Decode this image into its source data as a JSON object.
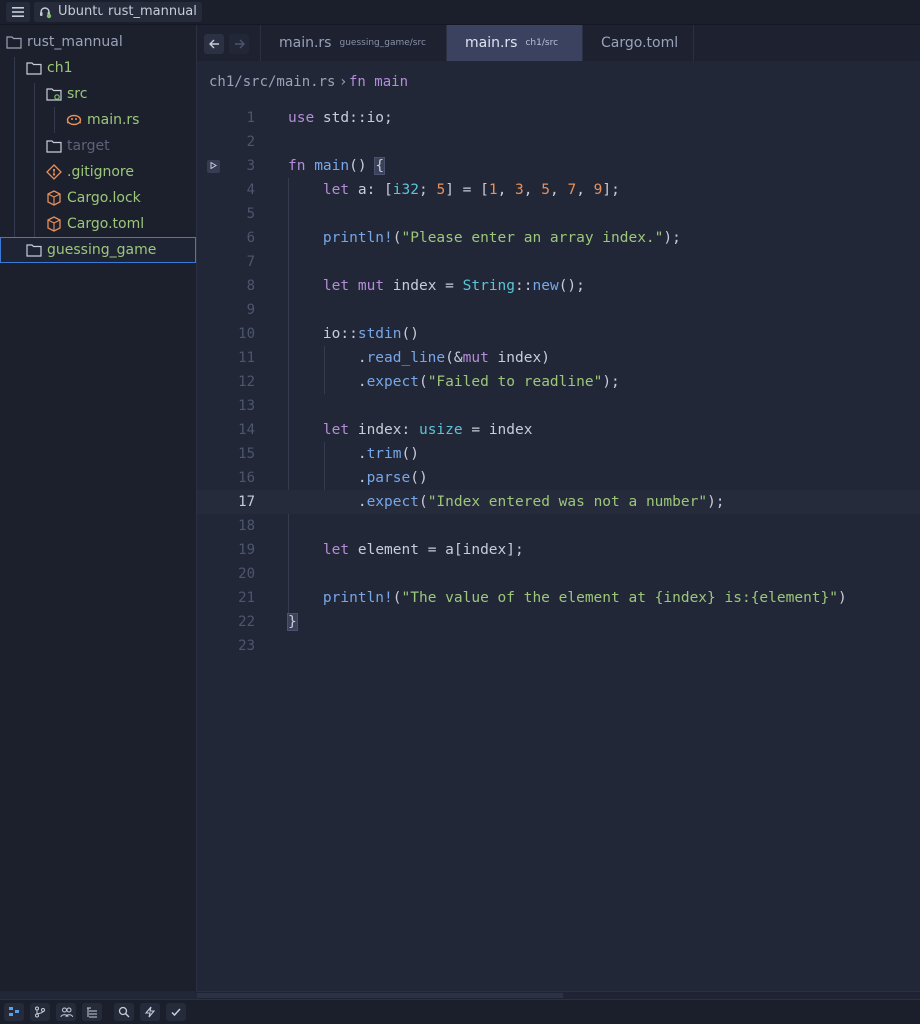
{
  "titlebar": {
    "os_label": "Ubuntu",
    "project_label": "rust_mannual"
  },
  "sidebar": {
    "root": "rust_mannual",
    "items": [
      {
        "label": "ch1",
        "kind": "folder-open"
      },
      {
        "label": "src",
        "kind": "folder-src"
      },
      {
        "label": "main.rs",
        "kind": "rust-file"
      },
      {
        "label": "target",
        "kind": "folder-closed"
      },
      {
        "label": ".gitignore",
        "kind": "git-file"
      },
      {
        "label": "Cargo.lock",
        "kind": "cargo-file"
      },
      {
        "label": "Cargo.toml",
        "kind": "cargo-file"
      },
      {
        "label": "guessing_game",
        "kind": "folder-closed"
      }
    ]
  },
  "tabs": [
    {
      "label": "main.rs",
      "sub": "guessing_game/src"
    },
    {
      "label": "main.rs",
      "sub": "ch1/src"
    },
    {
      "label": "Cargo.toml",
      "sub": ""
    }
  ],
  "breadcrumb": {
    "path": "ch1/src/main.rs",
    "separator": "›",
    "symbol": "fn main"
  },
  "editor": {
    "line_numbers": [
      "1",
      "2",
      "3",
      "4",
      "5",
      "6",
      "7",
      "8",
      "9",
      "10",
      "11",
      "12",
      "13",
      "14",
      "15",
      "16",
      "17",
      "18",
      "19",
      "20",
      "21",
      "22",
      "23"
    ],
    "current_line": "17",
    "code": {
      "l1_kw": "use",
      "l1_rest": " std::io;",
      "l3_kw": "fn",
      "l3_fn": " main",
      "l3_paren": "() ",
      "l3_brace": "{",
      "l4_kw": "let",
      "l4_a": " a: [",
      "l4_ty": "i32",
      "l4_semi": "; ",
      "l4_n5": "5",
      "l4_eq": "] = [",
      "l4_n1": "1",
      "l4_c1": ", ",
      "l4_n3": "3",
      "l4_c2": ", ",
      "l4_n5b": "5",
      "l4_c3": ", ",
      "l4_n7": "7",
      "l4_c4": ", ",
      "l4_n9": "9",
      "l4_end": "];",
      "l6_fn": "println!",
      "l6_open": "(",
      "l6_str": "\"Please enter an array index.\"",
      "l6_end": ");",
      "l8_kw": "let",
      "l8_mut": " mut",
      "l8_mid": " index = ",
      "l8_ty": "String",
      "l8_sep": "::",
      "l8_fn": "new",
      "l8_end": "();",
      "l10_a": "io::",
      "l10_fn": "stdin",
      "l10_end": "()",
      "l11_dot": ".",
      "l11_fn": "read_line",
      "l11_open": "(&",
      "l11_kw": "mut",
      "l11_end": " index)",
      "l12_dot": ".",
      "l12_fn": "expect",
      "l12_open": "(",
      "l12_str": "\"Failed to readline\"",
      "l12_end": ");",
      "l14_kw": "let",
      "l14_mid": " index: ",
      "l14_ty": "usize",
      "l14_end": " = index",
      "l15_dot": ".",
      "l15_fn": "trim",
      "l15_end": "()",
      "l16_dot": ".",
      "l16_fn": "parse",
      "l16_end": "()",
      "l17_dot": ".",
      "l17_fn": "expect",
      "l17_open": "(",
      "l17_str": "\"Index entered was not a number\"",
      "l17_end": ");",
      "l19_kw": "let",
      "l19_rest": " element = a[index];",
      "l21_fn": "println!",
      "l21_open": "(",
      "l21_str": "\"The value of the element at {index} is:{element}\"",
      "l21_end": ")",
      "l22_brace": "}"
    }
  },
  "colors": {
    "keyword": "#b48cd8",
    "function": "#77a7e8",
    "type": "#5cc4d8",
    "number": "#e8905a",
    "string": "#9cc77a",
    "selection": "#3b7ad8"
  }
}
